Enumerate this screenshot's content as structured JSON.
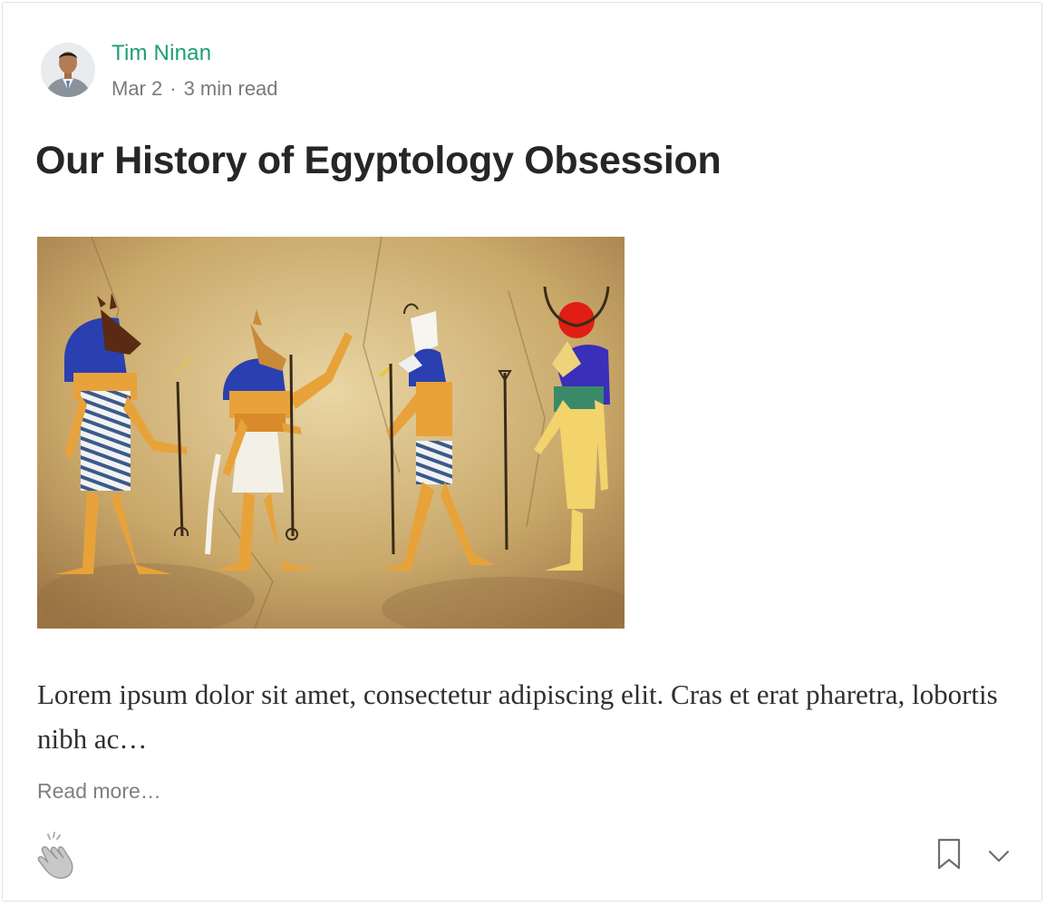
{
  "post": {
    "author": "Tim Ninan",
    "date": "Mar 2",
    "separator": "·",
    "read_time": "3 min read",
    "title": "Our History of Egyptology Obsession",
    "excerpt": "Lorem ipsum dolor sit amet, consectetur adipiscing elit. Cras et erat pharetra, lobortis nibh ac…",
    "read_more": "Read more…"
  },
  "icons": {
    "avatar": "author-avatar",
    "clap": "clap-icon",
    "bookmark": "bookmark-icon",
    "more": "chevron-down-icon"
  },
  "colors": {
    "author_link": "#1d9e74",
    "meta": "#7a7a7a",
    "title": "#262626",
    "icon": "#8a8a8a"
  }
}
